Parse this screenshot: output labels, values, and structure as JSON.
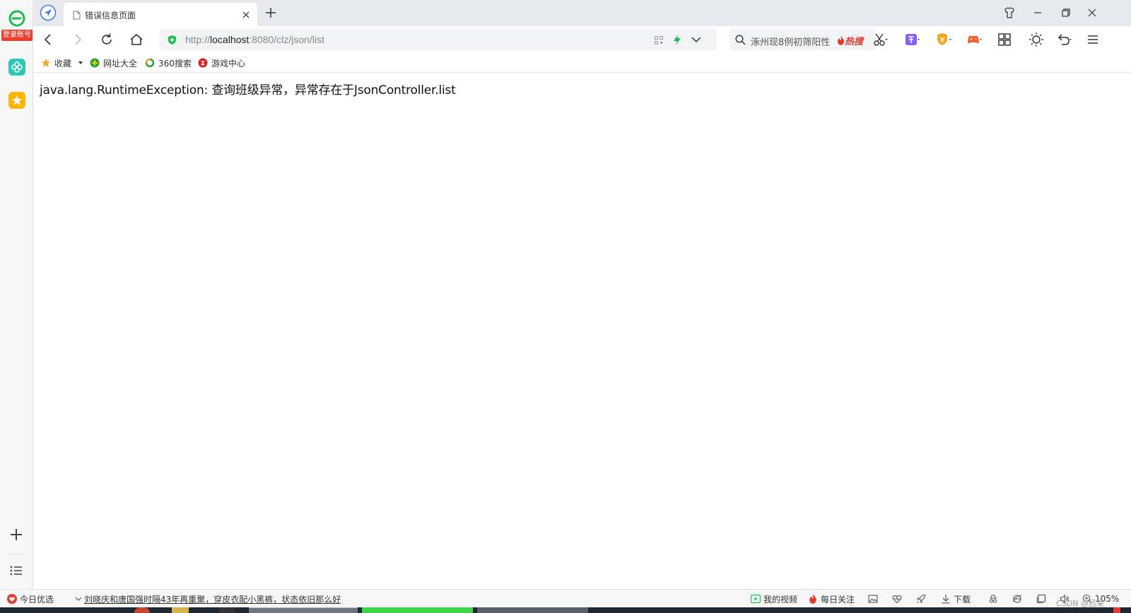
{
  "sidebar": {
    "login_label": "登录账号",
    "icons": [
      "browser-logo-icon",
      "clover-app-icon",
      "star-favorites-icon",
      "plus-icon",
      "list-icon"
    ]
  },
  "tabs": [
    {
      "title": "错误信息页面",
      "active": true
    }
  ],
  "address": {
    "url_prefix": "http://",
    "url_host": "localhost",
    "url_rest": ":8080/clz/json/list"
  },
  "search": {
    "text": "涿州现8例初筛阳性",
    "hot_label": "热搜"
  },
  "bookmarks": {
    "favorites": "收藏",
    "items": [
      "网址大全",
      "360搜索",
      "游戏中心"
    ]
  },
  "page": {
    "error_message": "java.lang.RuntimeException: 查询班级异常，异常存在于JsonController.list"
  },
  "statusbar": {
    "today_pick": "今日优选",
    "news": "刘晓庆和唐国强时隔43年再重聚，穿皮衣配小黑裤，状态依旧那么好",
    "my_video": "我的视频",
    "daily_focus": "每日关注",
    "download": "下载",
    "zoom": "105%",
    "watermark": "CSDN @吕采"
  },
  "colors": {
    "accent_green": "#1fb950",
    "hot_red": "#e53a2e",
    "tab_bar": "#e7e9ee"
  }
}
